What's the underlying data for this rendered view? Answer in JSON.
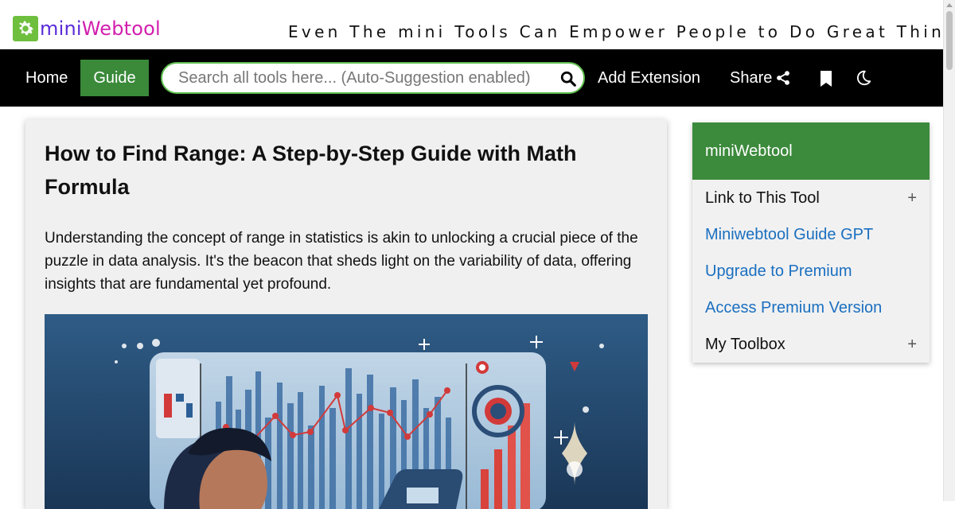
{
  "brand": {
    "logo_mini": "mini",
    "logo_web": "Webtool",
    "tagline": "Even The mini Tools Can Empower People to Do Great Things."
  },
  "nav": {
    "home": "Home",
    "guide": "Guide",
    "search_placeholder": "Search all tools here... (Auto-Suggestion enabled)",
    "add_extension": "Add Extension",
    "share": "Share"
  },
  "icons": {
    "search": "search-icon",
    "share": "share-icon",
    "bookmark": "bookmark-icon",
    "moon": "moon-icon",
    "gear": "gear-icon"
  },
  "article": {
    "title": "How to Find Range: A Step-by-Step Guide with Math Formula",
    "intro": "Understanding the concept of range in statistics is akin to unlocking a crucial piece of the puzzle in data analysis. It's the beacon that sheds light on the variability of data, offering insights that are fundamental yet profound."
  },
  "sidebar": {
    "header": "miniWebtool",
    "items": [
      {
        "label": "Link to This Tool",
        "expandable": "+"
      },
      {
        "label": "Miniwebtool Guide GPT"
      },
      {
        "label": "Upgrade to Premium"
      },
      {
        "label": "Access Premium Version"
      },
      {
        "label": "My Toolbox",
        "expandable": "+"
      }
    ]
  },
  "colors": {
    "nav_bg": "#000000",
    "accent_green": "#3c8a3c",
    "link_blue": "#1a6fc0",
    "logo_purple": "#5a2cd8",
    "logo_magenta": "#d21fae"
  }
}
